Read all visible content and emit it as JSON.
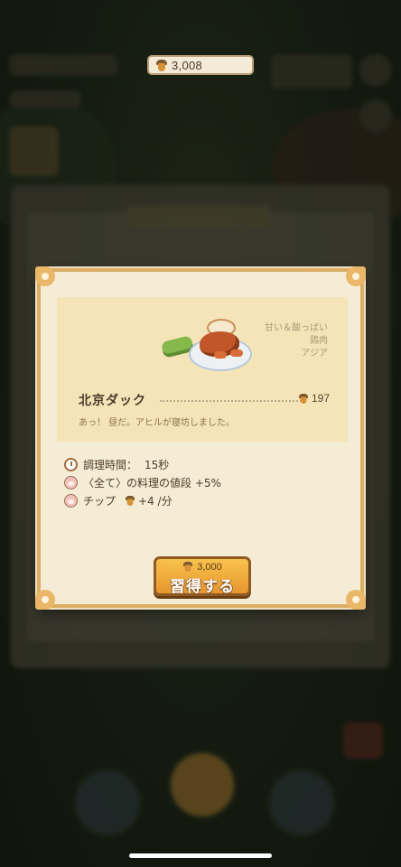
{
  "currency": {
    "icon": "acorn-icon",
    "amount": "3,008"
  },
  "recipe": {
    "name": "北京ダック",
    "price": "197",
    "description": "あっ！ 昼だ。アヒルが寝坊しました。",
    "attributes": {
      "taste": "甘い＆酸っぱい",
      "ingredient": "鶏肉",
      "region": "アジア"
    }
  },
  "stats": {
    "cook_time_label": "調理時間：",
    "cook_time_value": "15秒",
    "bonus_text": "〈全て〉の料理の値段 +5%",
    "tip_label": "チップ",
    "tip_value": "+4 /分"
  },
  "learn_button": {
    "cost": "3,000",
    "label": "習得する"
  },
  "colors": {
    "accent": "#e7962f",
    "panel": "#f5ecd5",
    "frame": "#dbad65"
  }
}
